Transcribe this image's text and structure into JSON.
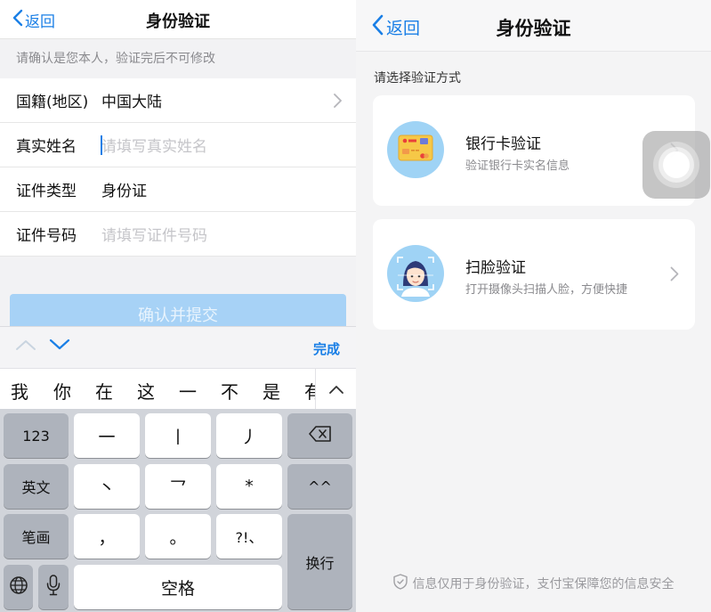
{
  "left": {
    "nav": {
      "back_label": "返回",
      "title": "身份验证"
    },
    "hint": "请确认是您本人，验证完后不可修改",
    "form": {
      "nationality_label": "国籍(地区)",
      "nationality_value": "中国大陆",
      "name_label": "真实姓名",
      "name_placeholder": "请填写真实姓名",
      "idtype_label": "证件类型",
      "idtype_value": "身份证",
      "idno_label": "证件号码",
      "idno_placeholder": "请填写证件号码"
    },
    "submit_label": "确认并提交",
    "keyboard": {
      "done_label": "完成",
      "candidates": [
        "我",
        "你",
        "在",
        "这",
        "一",
        "不",
        "是",
        "有"
      ],
      "keys": {
        "num": "123",
        "k1": "一",
        "k2": "丨",
        "k3": "丿",
        "english": "英文",
        "k4": "丶",
        "k5": "乛",
        "k6": "*",
        "k7": "^^",
        "stroke": "笔画",
        "comma": "，",
        "period": "。",
        "punct": "?!、",
        "newline": "换行",
        "space": "空格"
      },
      "icons": [
        "chevron-up-icon",
        "chevron-down-icon",
        "expand-up-icon",
        "backspace-icon",
        "globe-icon",
        "microphone-icon"
      ]
    }
  },
  "right": {
    "nav": {
      "back_label": "返回",
      "title": "身份验证"
    },
    "hint": "请选择验证方式",
    "options": [
      {
        "title": "银行卡验证",
        "subtitle": "验证银行卡实名信息",
        "icon": "bank-card-icon"
      },
      {
        "title": "扫脸验证",
        "subtitle": "打开摄像头扫描人脸，方便快捷",
        "icon": "face-scan-icon"
      }
    ],
    "footer": "信息仅用于身份验证，支付宝保障您的信息安全"
  },
  "colors": {
    "accent": "#1a7fe6",
    "button_disabled": "#a7d2f6",
    "keyboard_bg": "#d1d4da"
  }
}
